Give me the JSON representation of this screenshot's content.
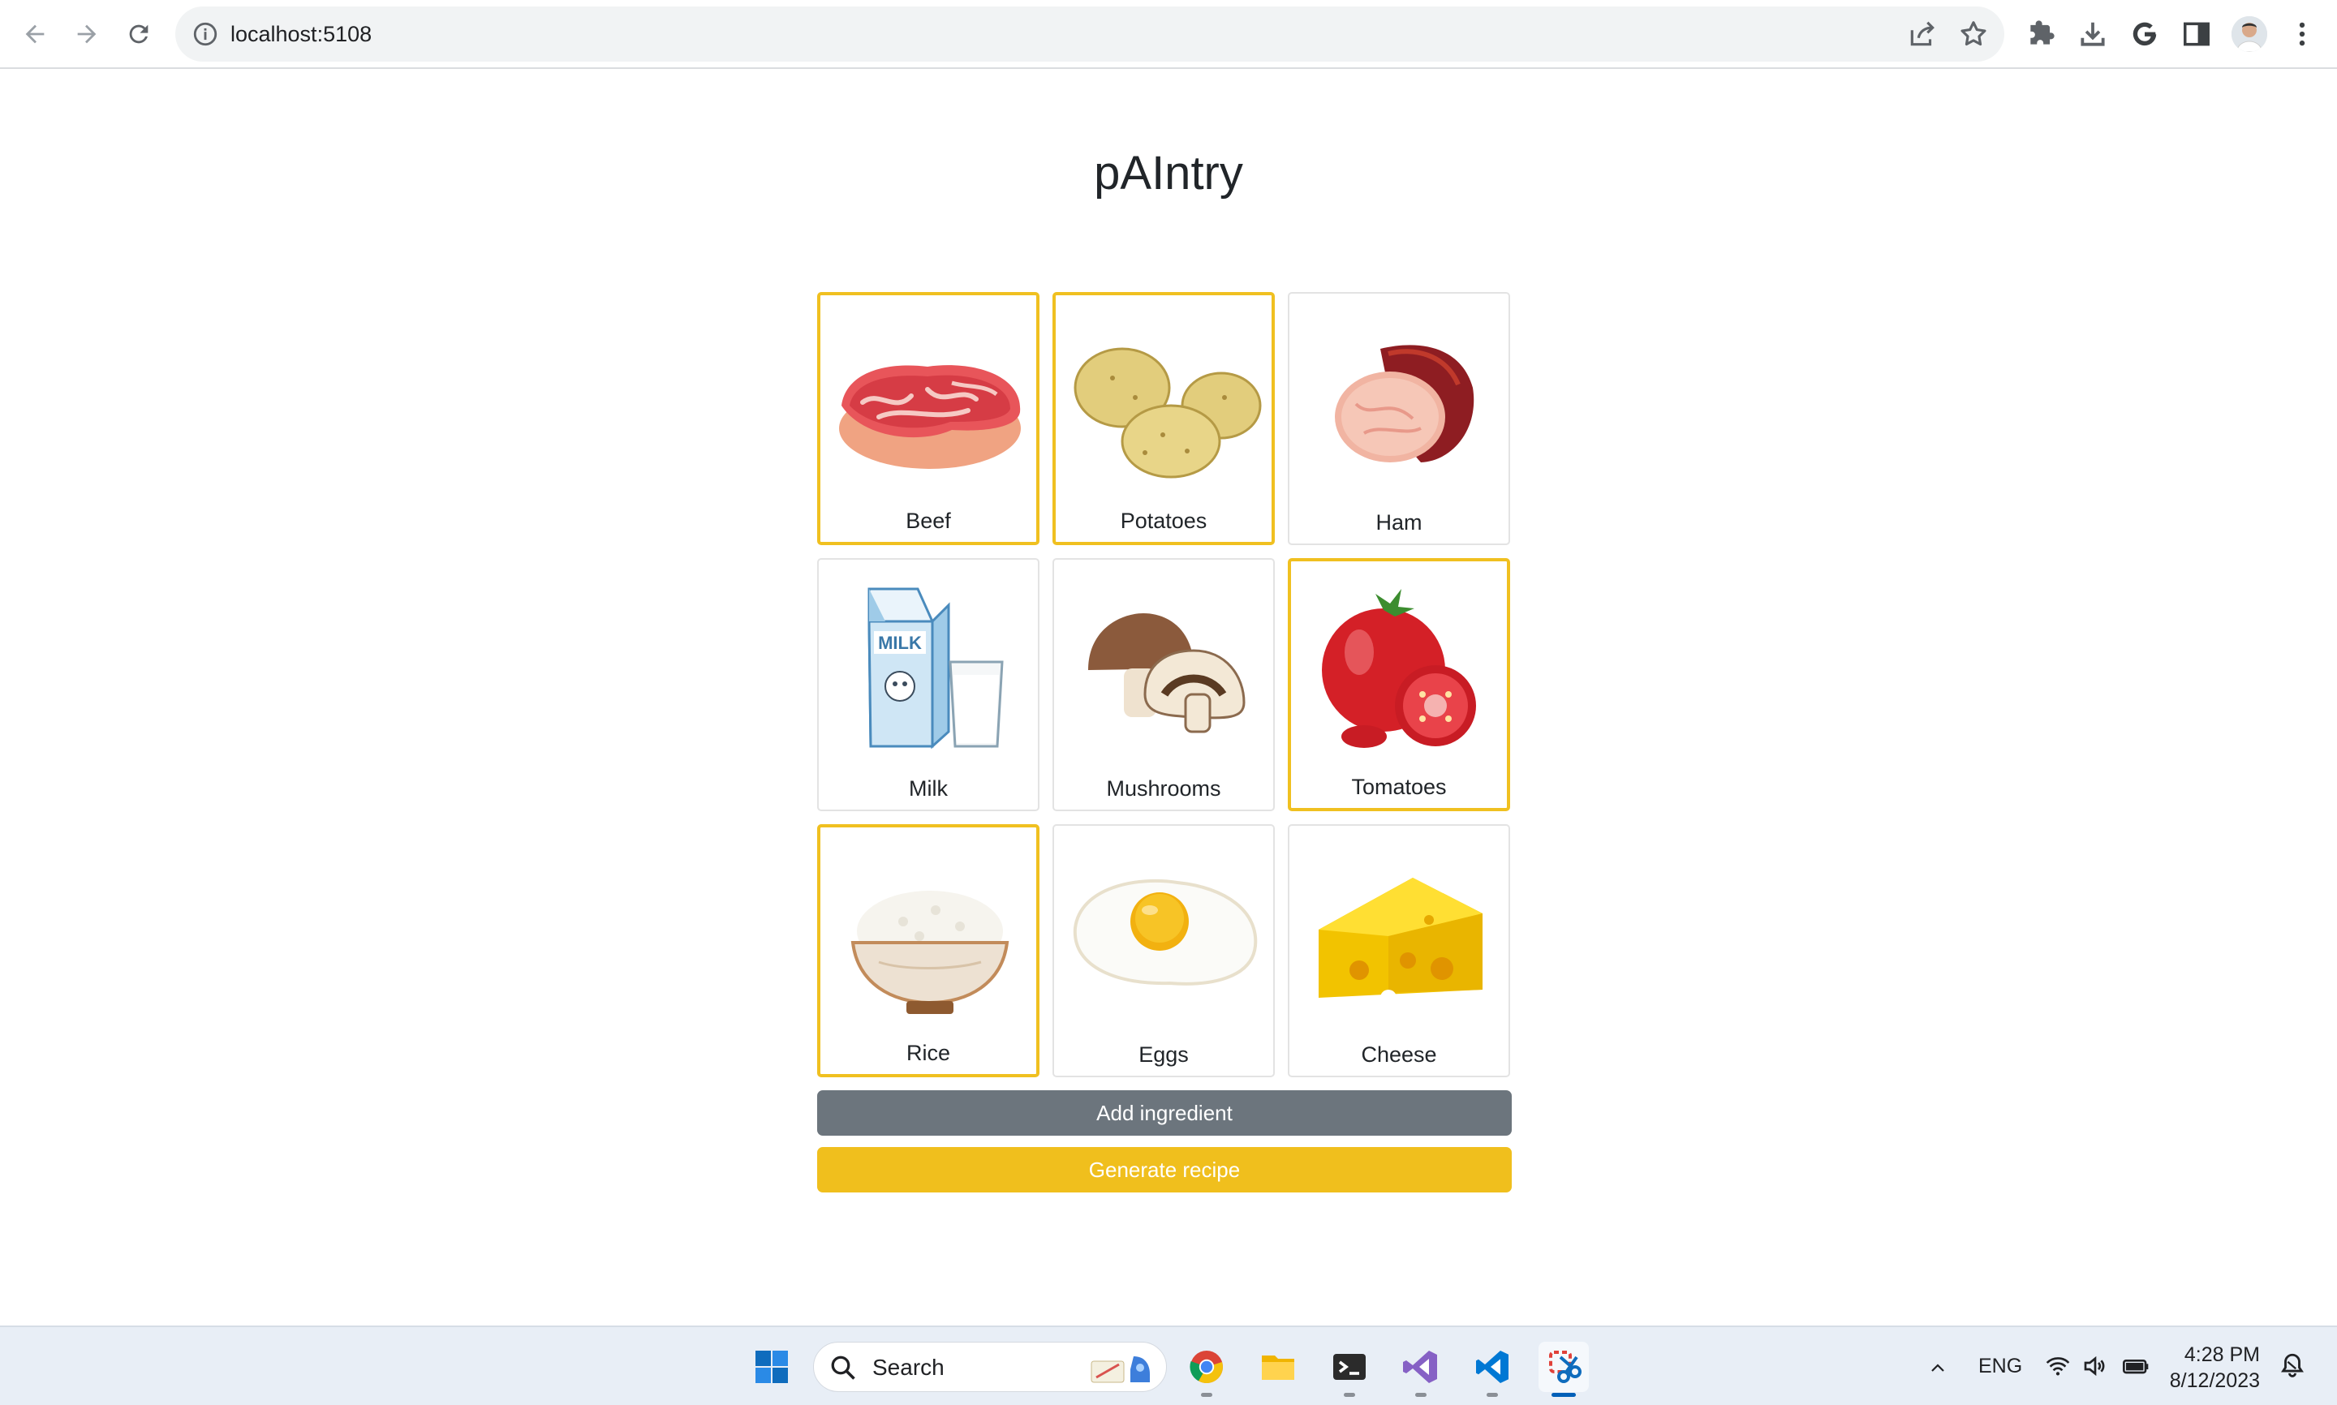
{
  "browser": {
    "url": "localhost:5108"
  },
  "page": {
    "title": "pAIntry",
    "ingredients": [
      {
        "name": "Beef",
        "selected": true,
        "icon": "beef-steak"
      },
      {
        "name": "Potatoes",
        "selected": true,
        "icon": "potatoes"
      },
      {
        "name": "Ham",
        "selected": false,
        "icon": "ham"
      },
      {
        "name": "Milk",
        "selected": false,
        "icon": "milk-carton-glass"
      },
      {
        "name": "Mushrooms",
        "selected": false,
        "icon": "mushrooms"
      },
      {
        "name": "Tomatoes",
        "selected": true,
        "icon": "tomatoes"
      },
      {
        "name": "Rice",
        "selected": true,
        "icon": "rice-bowl"
      },
      {
        "name": "Eggs",
        "selected": false,
        "icon": "fried-egg"
      },
      {
        "name": "Cheese",
        "selected": false,
        "icon": "cheese-wedge"
      }
    ],
    "add_button": "Add ingredient",
    "generate_button": "Generate recipe"
  },
  "taskbar": {
    "search_placeholder": "Search",
    "language": "ENG",
    "time": "4:28 PM",
    "date": "8/12/2023"
  },
  "colors": {
    "selected_border": "#f0c020",
    "add_button": "#6c757d",
    "generate_button": "#f0bf1d"
  }
}
